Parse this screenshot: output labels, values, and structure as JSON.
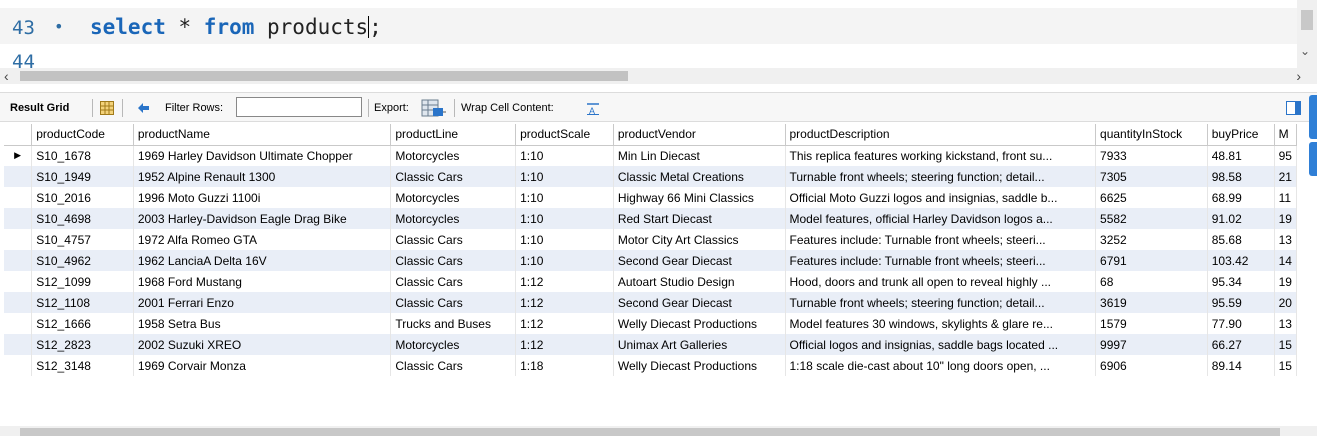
{
  "editor": {
    "line_active": "43",
    "line_next": "44",
    "sql": {
      "kw_select": "select",
      "star": " * ",
      "kw_from": "from",
      "table": " products",
      "terminator": ";"
    }
  },
  "toolbar": {
    "result_grid": "Result Grid",
    "filter_rows": "Filter Rows:",
    "filter_value": "",
    "export": "Export:",
    "wrap_cell": "Wrap Cell Content:"
  },
  "grid": {
    "columns": [
      "productCode",
      "productName",
      "productLine",
      "productScale",
      "productVendor",
      "productDescription",
      "quantityInStock",
      "buyPrice",
      "M"
    ],
    "rows": [
      [
        "S10_1678",
        "1969 Harley Davidson Ultimate Chopper",
        "Motorcycles",
        "1:10",
        "Min Lin Diecast",
        "This replica features working kickstand, front su...",
        "7933",
        "48.81",
        "95"
      ],
      [
        "S10_1949",
        "1952 Alpine Renault 1300",
        "Classic Cars",
        "1:10",
        "Classic Metal Creations",
        "Turnable front wheels; steering function; detail...",
        "7305",
        "98.58",
        "21"
      ],
      [
        "S10_2016",
        "1996 Moto Guzzi 1100i",
        "Motorcycles",
        "1:10",
        "Highway 66 Mini Classics",
        "Official Moto Guzzi logos and insignias, saddle b...",
        "6625",
        "68.99",
        "11"
      ],
      [
        "S10_4698",
        "2003 Harley-Davidson Eagle Drag Bike",
        "Motorcycles",
        "1:10",
        "Red Start Diecast",
        "Model features, official Harley Davidson logos a...",
        "5582",
        "91.02",
        "19"
      ],
      [
        "S10_4757",
        "1972 Alfa Romeo GTA",
        "Classic Cars",
        "1:10",
        "Motor City Art Classics",
        "Features include: Turnable front wheels; steeri...",
        "3252",
        "85.68",
        "13"
      ],
      [
        "S10_4962",
        "1962 LanciaA Delta 16V",
        "Classic Cars",
        "1:10",
        "Second Gear Diecast",
        "Features include: Turnable front wheels; steeri...",
        "6791",
        "103.42",
        "14"
      ],
      [
        "S12_1099",
        "1968 Ford Mustang",
        "Classic Cars",
        "1:12",
        "Autoart Studio Design",
        "Hood, doors and trunk all open to reveal highly ...",
        "68",
        "95.34",
        "19"
      ],
      [
        "S12_1108",
        "2001 Ferrari Enzo",
        "Classic Cars",
        "1:12",
        "Second Gear Diecast",
        "Turnable front wheels; steering function; detail...",
        "3619",
        "95.59",
        "20"
      ],
      [
        "S12_1666",
        "1958 Setra Bus",
        "Trucks and Buses",
        "1:12",
        "Welly Diecast Productions",
        "Model features 30 windows, skylights & glare re...",
        "1579",
        "77.90",
        "13"
      ],
      [
        "S12_2823",
        "2002 Suzuki XREO",
        "Motorcycles",
        "1:12",
        "Unimax Art Galleries",
        "Official logos and insignias, saddle bags located ...",
        "9997",
        "66.27",
        "15"
      ],
      [
        "S12_3148",
        "1969 Corvair Monza",
        "Classic Cars",
        "1:18",
        "Welly Diecast Productions",
        "1:18 scale die-cast about 10\" long doors open, ...",
        "6906",
        "89.14",
        "15"
      ]
    ]
  },
  "colors": {
    "keyword": "#1a66b8",
    "line_number": "#2e6da4",
    "alt_row": "#e9eef7",
    "accent": "#2f7fd6"
  },
  "icons": {
    "row_indicator": "current-row-arrow-icon",
    "grid": "grid-icon",
    "refresh": "refresh-icon",
    "export": "export-icon",
    "wrap": "wrap-text-icon",
    "panel": "panel-toggle-icon"
  }
}
